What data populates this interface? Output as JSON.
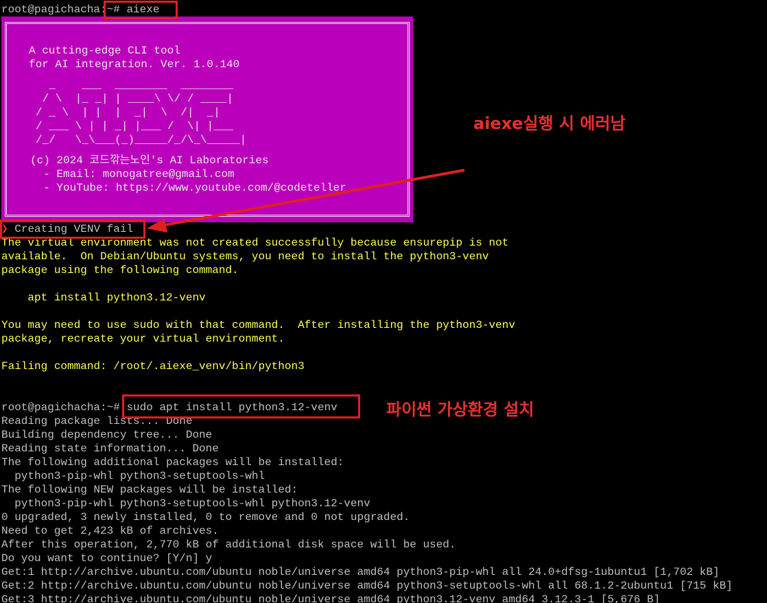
{
  "colors": {
    "background": "#000000",
    "text": "#c0c0c0",
    "warning_text": "#ffff55",
    "banner_bg": "#bb00bb",
    "banner_text": "#e8e8e8",
    "annotation": "#e02020"
  },
  "prompt1": {
    "host": "root@pagichacha",
    "path": ":~# ",
    "command": "aiexe"
  },
  "banner": {
    "tagline1": "A cutting-edge CLI tool",
    "tagline2": "for AI integration. Ver. 1.0.140",
    "ascii": [
      "  _    ___  ________  ________",
      " / \\  |_ _| | ____\\ \\/ / ____|",
      "/ _ \\  | |  |  _|  \\  /|  _|",
      "/ ___ \\ | | _| |___ /  \\| |___",
      "/_/   \\_\\___(_)_____/_/\\_\\_____|"
    ],
    "copyright": "(c) 2024 코드깎는노인's AI Laboratories",
    "email": "  - Email: monogatree@gmail.com",
    "youtube": "  - YouTube: https://www.youtube.com/@codeteller"
  },
  "error": {
    "marker": "❯",
    "title": " Creating VENV fail",
    "lines": [
      "The virtual environment was not created successfully because ensurepip is not",
      "available.  On Debian/Ubuntu systems, you need to install the python3-venv",
      "package using the following command.",
      "",
      "    apt install python3.12-venv",
      "",
      "You may need to use sudo with that command.  After installing the python3-venv",
      "package, recreate your virtual environment.",
      "",
      "Failing command: /root/.aiexe_venv/bin/python3"
    ]
  },
  "prompt2": {
    "host": "root@pagichacha",
    "path": ":~# ",
    "command": "sudo apt install python3.12-venv"
  },
  "apt_output": [
    "Reading package lists... Done",
    "Building dependency tree... Done",
    "Reading state information... Done",
    "The following additional packages will be installed:",
    "  python3-pip-whl python3-setuptools-whl",
    "The following NEW packages will be installed:",
    "  python3-pip-whl python3-setuptools-whl python3.12-venv",
    "0 upgraded, 3 newly installed, 0 to remove and 0 not upgraded.",
    "Need to get 2,423 kB of archives.",
    "After this operation, 2,770 kB of additional disk space will be used.",
    "Do you want to continue? [Y/n] y",
    "Get:1 http://archive.ubuntu.com/ubuntu noble/universe amd64 python3-pip-whl all 24.0+dfsg-1ubuntu1 [1,702 kB]",
    "Get:2 http://archive.ubuntu.com/ubuntu noble/universe amd64 python3-setuptools-whl all 68.1.2-2ubuntu1 [715 kB]",
    "Get:3 http://archive.ubuntu.com/ubuntu noble/universe amd64 python3.12-venv amd64 3.12.3-1 [5,676 B]"
  ],
  "annotations": {
    "error_note": "aiexe실행 시 에러남",
    "install_note": "파이썬 가상환경 설치"
  }
}
